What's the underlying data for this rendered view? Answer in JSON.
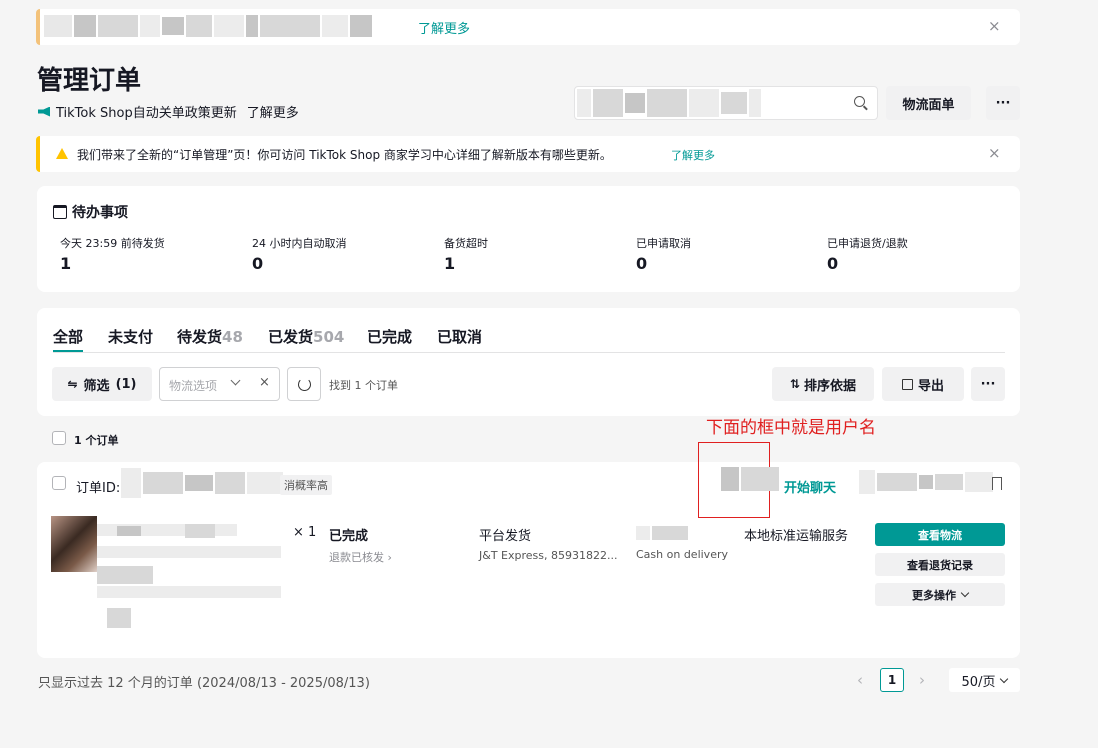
{
  "top_banner": {
    "link": "了解更多",
    "close": "×"
  },
  "header": {
    "title": "管理订单",
    "policy_text": "TikTok Shop自动关单政策更新",
    "policy_link": "了解更多",
    "logistics_button": "物流面单",
    "more_button": "···"
  },
  "notice": {
    "text": "我们带来了全新的“订单管理”页！你可访问 TikTok Shop 商家学习中心详细了解新版本有哪些更新。",
    "link": "了解更多",
    "close": "×"
  },
  "todo": {
    "title": "待办事项",
    "stats": [
      {
        "label": "今天 23:59 前待发货",
        "value": "1"
      },
      {
        "label": "24 小时内自动取消",
        "value": "0"
      },
      {
        "label": "备货超时",
        "value": "1"
      },
      {
        "label": "已申请取消",
        "value": "0"
      },
      {
        "label": "已申请退货/退款",
        "value": "0"
      }
    ]
  },
  "tabs": [
    {
      "label": "全部",
      "count": ""
    },
    {
      "label": "未支付",
      "count": ""
    },
    {
      "label": "待发货",
      "count": "48"
    },
    {
      "label": "已发货",
      "count": "504"
    },
    {
      "label": "已完成",
      "count": ""
    },
    {
      "label": "已取消",
      "count": ""
    }
  ],
  "toolbar": {
    "filter": "筛选",
    "filter_count": "(1)",
    "logistics_placeholder": "物流选项",
    "found_text": "找到 1 个订单",
    "sort": "排序依据",
    "export": "导出",
    "more": "···"
  },
  "annotation": {
    "text": "下面的框中就是用户名",
    "color": "#e02020"
  },
  "orders": {
    "select_label": "1 个订单",
    "order_id_label": "订单ID:",
    "risk_badge": "消概率高",
    "chat_link": "开始聊天",
    "quantity": "× 1",
    "status": "已完成",
    "refund_status": "退款已核发 ›",
    "shipping_type": "平台发货",
    "carrier": "J&T Express, 85931822...",
    "payment": "Cash on delivery",
    "service": "本地标准运输服务",
    "actions": {
      "track": "查看物流",
      "return_record": "查看退货记录",
      "more": "更多操作"
    }
  },
  "footer": {
    "note": "只显示过去 12 个月的订单 (2024/08/13 - 2025/08/13)",
    "page": "1",
    "prev": "‹",
    "next": "›",
    "per_page": "50/页"
  },
  "colors": {
    "accent": "#009995",
    "warning": "#ffc300",
    "annotation": "#e02020"
  }
}
